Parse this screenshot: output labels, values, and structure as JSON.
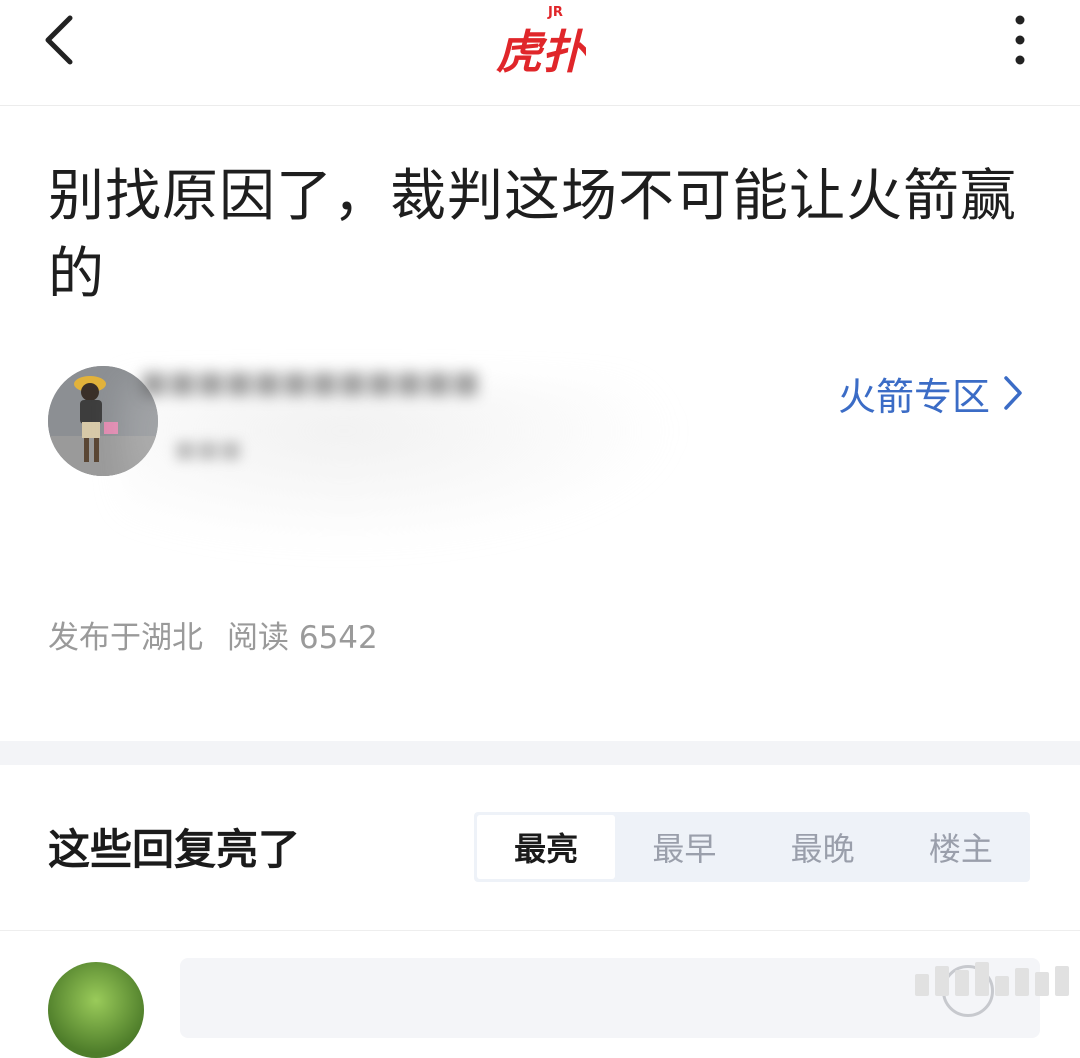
{
  "topbar": {
    "back_icon": "chevron-left-icon",
    "logo_text": "虎扑",
    "logo_badge": "JR",
    "logo_color": "#e0262a",
    "more_icon": "more-vertical-icon"
  },
  "post": {
    "title": "别找原因了，裁判这场不可能让火箭赢的",
    "zone_link": "火箭专区",
    "meta_location": "发布于湖北",
    "meta_reads": "阅读 6542"
  },
  "replies": {
    "section_title": "这些回复亮了",
    "tabs": [
      {
        "label": "最亮",
        "active": true
      },
      {
        "label": "最早",
        "active": false
      },
      {
        "label": "最晚",
        "active": false
      },
      {
        "label": "楼主",
        "active": false
      }
    ]
  },
  "colors": {
    "accent_link": "#3b6cc6",
    "meta_gray": "#9a9a9a",
    "band_bg": "#f3f4f7"
  }
}
